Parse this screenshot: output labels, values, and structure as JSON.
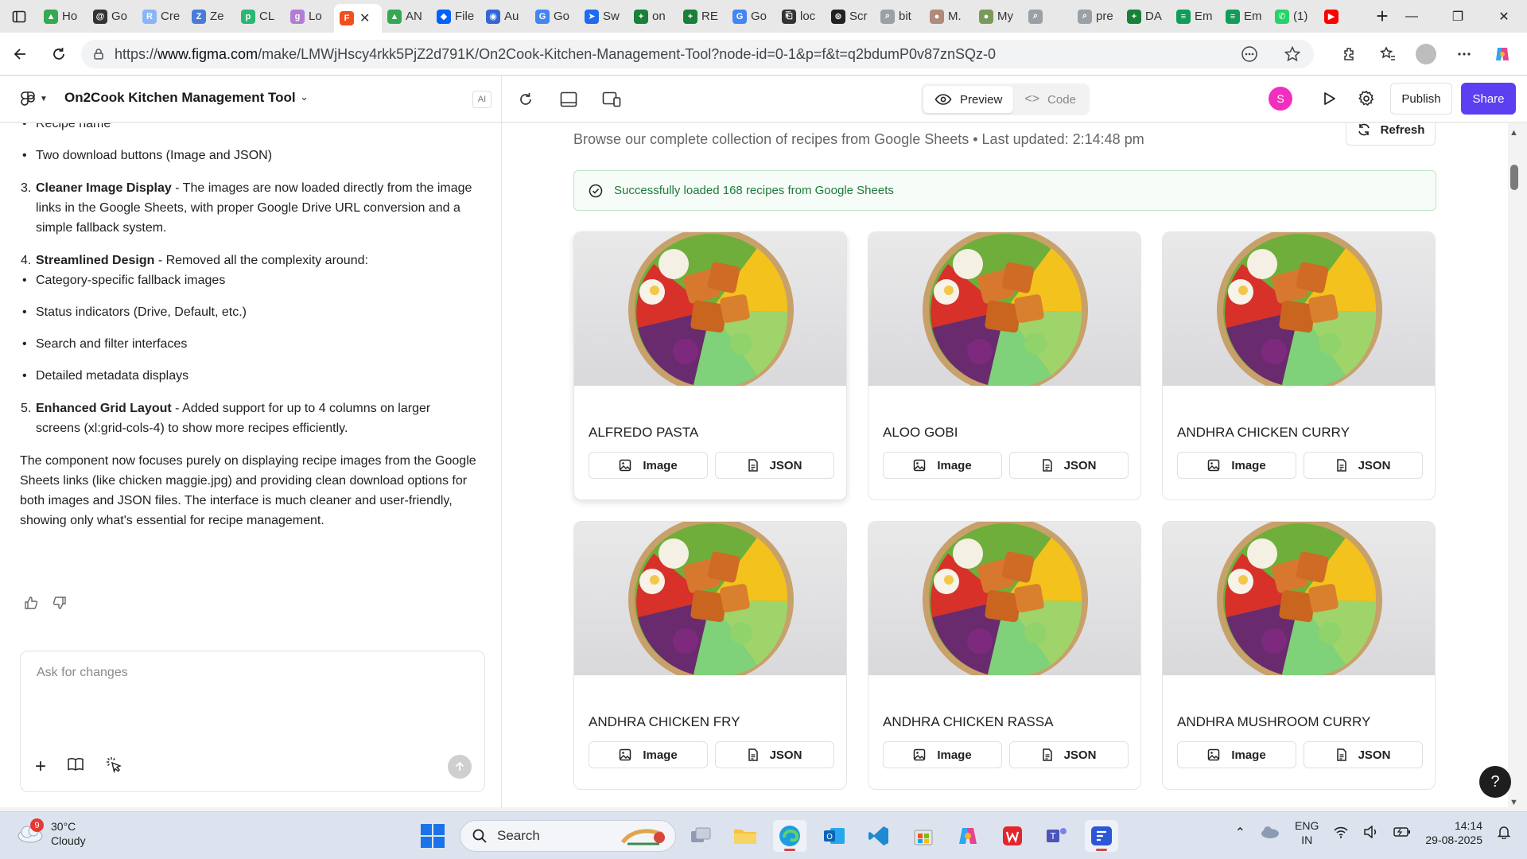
{
  "browser": {
    "tabs": [
      {
        "label": "Ho",
        "color": "#34a853",
        "glyph": "▲"
      },
      {
        "label": "Go",
        "color": "#333333",
        "glyph": "@"
      },
      {
        "label": "Cre",
        "color": "#8ab4f8",
        "glyph": "R"
      },
      {
        "label": "Ze",
        "color": "#4a7bd8",
        "glyph": "Z"
      },
      {
        "label": "CL",
        "color": "#2bb673",
        "glyph": "p"
      },
      {
        "label": "Lo",
        "color": "#b37dd6",
        "glyph": "g"
      },
      {
        "label": "",
        "color": "#f24e1e",
        "glyph": "F",
        "active": true
      },
      {
        "label": "AN",
        "color": "#34a853",
        "glyph": "▲"
      },
      {
        "label": "File",
        "color": "#0061fe",
        "glyph": "◆"
      },
      {
        "label": "Au",
        "color": "#3367d6",
        "glyph": "◉"
      },
      {
        "label": "Go",
        "color": "#4285f4",
        "glyph": "G"
      },
      {
        "label": "Sw",
        "color": "#1e6bf0",
        "glyph": "➤"
      },
      {
        "label": "on",
        "color": "#188038",
        "glyph": "+"
      },
      {
        "label": "RE",
        "color": "#188038",
        "glyph": "+"
      },
      {
        "label": "Go",
        "color": "#4285f4",
        "glyph": "G"
      },
      {
        "label": "loc",
        "color": "#333333",
        "glyph": "⎗"
      },
      {
        "label": "Scr",
        "color": "#222222",
        "glyph": "⊛"
      },
      {
        "label": "bit",
        "color": "#9aa0a6",
        "glyph": "⌕"
      },
      {
        "label": "M.",
        "color": "#b08a7a",
        "glyph": "●"
      },
      {
        "label": "My",
        "color": "#7a9a5a",
        "glyph": "●"
      },
      {
        "label": "",
        "color": "#9aa0a6",
        "glyph": "⌕"
      },
      {
        "label": "pre",
        "color": "#9aa0a6",
        "glyph": "⌕"
      },
      {
        "label": "DA",
        "color": "#188038",
        "glyph": "+"
      },
      {
        "label": "Em",
        "color": "#0f9d58",
        "glyph": "≡"
      },
      {
        "label": "Em",
        "color": "#0f9d58",
        "glyph": "≡"
      },
      {
        "label": "(1)",
        "color": "#25d366",
        "glyph": "✆"
      },
      {
        "label": "",
        "color": "#ff0000",
        "glyph": "▶"
      }
    ],
    "url_prefix": "https://",
    "url_domain": "www.figma.com",
    "url_path": "/make/LMWjHscy4rkk5PjZ2d791K/On2Cook-Kitchen-Management-Tool?node-id=0-1&p=f&t=q2bdumP0v87znSQz-0"
  },
  "figma": {
    "project_title": "On2Cook Kitchen Management Tool",
    "ai_badge": "AI",
    "preview_label": "Preview",
    "code_label": "Code",
    "user_initial": "S",
    "publish_label": "Publish",
    "share_label": "Share",
    "accent": "#5b3ff0"
  },
  "chat": {
    "bullets_top": [
      "Recipe name",
      "Two download buttons (Image and JSON)"
    ],
    "item3_num": "3.",
    "item3_title": "Cleaner Image Display",
    "item3_text": " - The images are now loaded directly from the image links in the Google Sheets, with proper Google Drive URL conversion and a simple fallback system.",
    "item4_num": "4.",
    "item4_title": "Streamlined Design",
    "item4_text": " - Removed all the complexity around:",
    "bullets_mid": [
      "Category-specific fallback images",
      "Status indicators (Drive, Default, etc.)",
      "Search and filter interfaces",
      "Detailed metadata displays"
    ],
    "item5_num": "5.",
    "item5_title": "Enhanced Grid Layout",
    "item5_text": " - Added support for up to 4 columns on larger screens (xl:grid-cols-4) to show more recipes efficiently.",
    "summary": "The component now focuses purely on displaying recipe images from the Google Sheets links (like chicken maggie.jpg) and providing clean download options for both images and JSON files. The interface is much cleaner and user-friendly, showing only what's essential for recipe management.",
    "input_placeholder": "Ask for changes"
  },
  "preview": {
    "subtitle": "Browse our complete collection of recipes from Google Sheets  • Last updated: 2:14:48 pm",
    "refresh_label": "Refresh",
    "success_message": "Successfully loaded 168 recipes from Google Sheets",
    "image_btn": "Image",
    "json_btn": "JSON",
    "recipes": [
      "ALFREDO PASTA",
      "ALOO GOBI",
      "ANDHRA CHICKEN CURRY",
      "ANDHRA CHICKEN FRY",
      "ANDHRA CHICKEN RASSA",
      "ANDHRA MUSHROOM CURRY"
    ]
  },
  "taskbar": {
    "weather_badge": "9",
    "temperature": "30°C",
    "condition": "Cloudy",
    "search_label": "Search",
    "lang_1": "ENG",
    "lang_2": "IN",
    "time": "14:14",
    "date": "29-08-2025"
  }
}
